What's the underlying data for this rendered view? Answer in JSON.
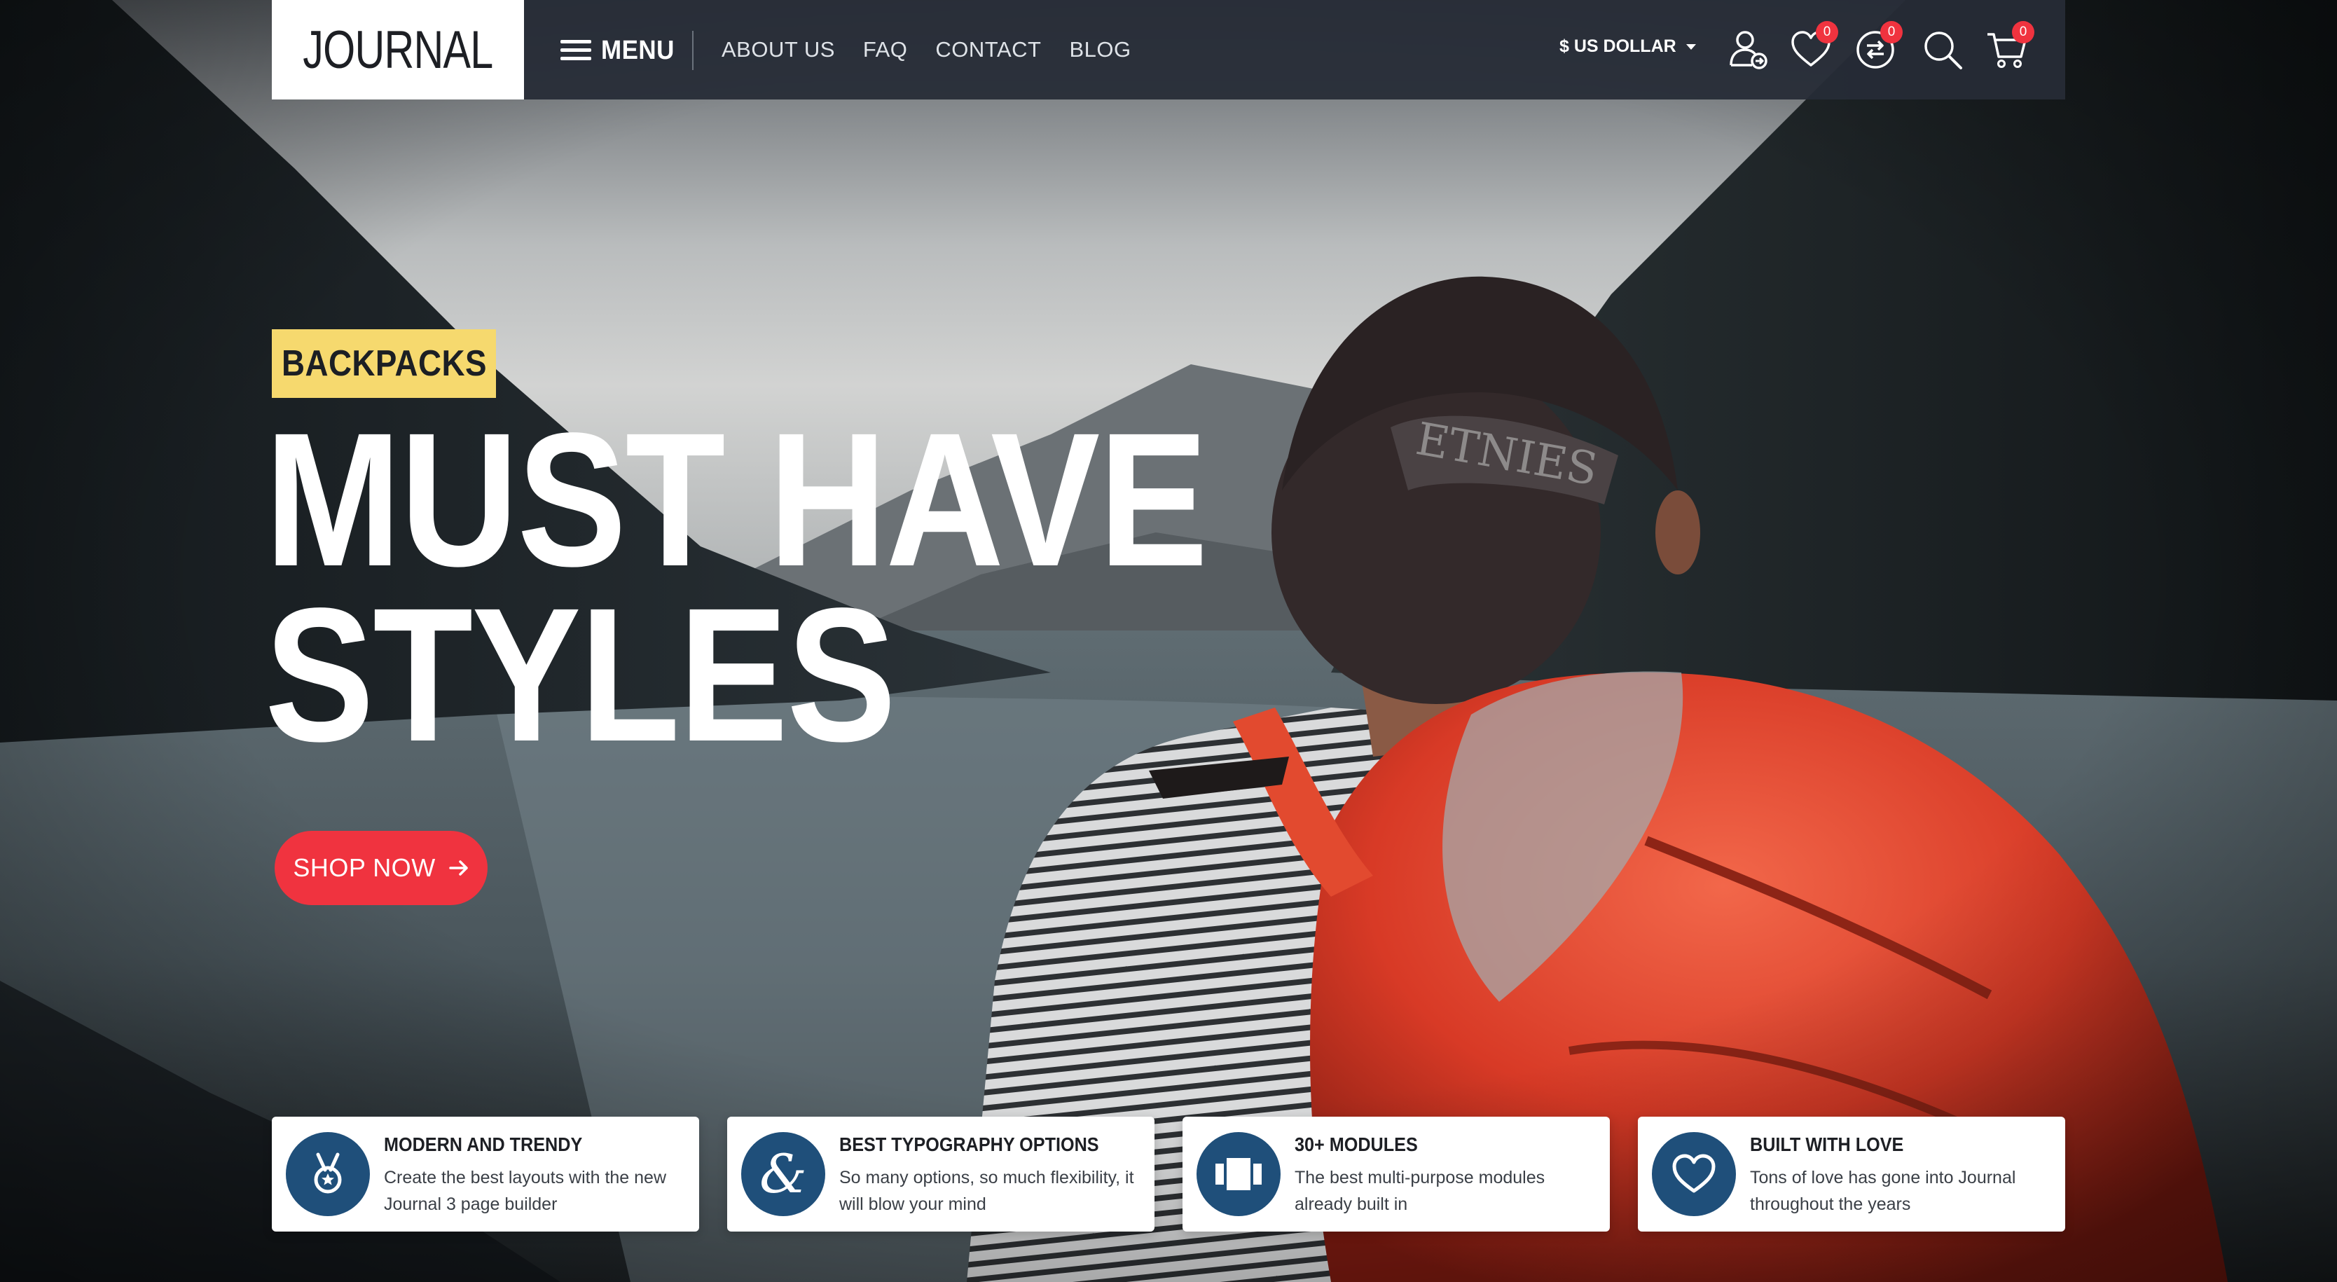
{
  "header": {
    "logo": "JOURNAL",
    "menu_label": "MENU",
    "nav": [
      "ABOUT US",
      "FAQ",
      "CONTACT",
      "BLOG"
    ],
    "currency": "$ US DOLLAR",
    "icons": [
      {
        "name": "account-icon"
      },
      {
        "name": "wishlist-heart-icon",
        "badge": "0"
      },
      {
        "name": "compare-icon",
        "badge": "0"
      },
      {
        "name": "search-icon"
      },
      {
        "name": "cart-icon",
        "badge": "0"
      }
    ],
    "badge_color": "#f0333f"
  },
  "hero": {
    "tag": "BACKPACKS",
    "headline_line1": "MUST HAVE",
    "headline_line2": "STYLES",
    "cta": "SHOP NOW",
    "cta_color": "#f0333f",
    "tag_color": "#f6d96e"
  },
  "features": [
    {
      "icon": "medal-icon",
      "title": "MODERN AND TRENDY",
      "desc": "Create the best layouts with the new Journal 3 page builder"
    },
    {
      "icon": "ampersand-icon",
      "title": "BEST TYPOGRAPHY OPTIONS",
      "desc": "So many options, so much flexibility, it will blow your mind"
    },
    {
      "icon": "modules-icon",
      "title": "30+ MODULES",
      "desc": "The best multi-purpose modules already built in"
    },
    {
      "icon": "heart-icon",
      "title": "BUILT WITH LOVE",
      "desc": "Tons of love has gone into Journal throughout the years"
    }
  ],
  "feature_icon_color": "#1f4f7a"
}
